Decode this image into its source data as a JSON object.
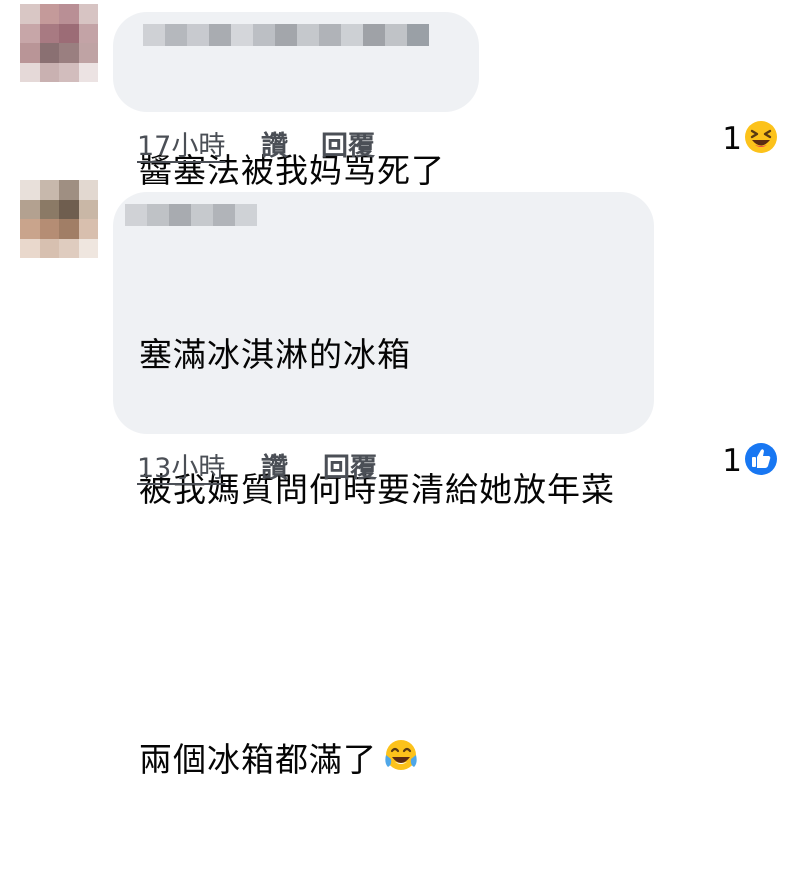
{
  "comments": [
    {
      "text_lines": [
        "醬塞法被我妈骂死了"
      ],
      "time": "17小時",
      "like_label": "讚",
      "reply_label": "回覆",
      "reaction_count": "1",
      "reaction_icon": "laughing-squint-emoji-icon"
    },
    {
      "text_lines": [
        "塞滿冰淇淋的冰箱",
        "被我媽質問何時要清給她放年菜",
        "",
        "兩個冰箱都滿了"
      ],
      "inline_emoji": "tears-of-joy-emoji-icon",
      "time": "13小時",
      "like_label": "讚",
      "reply_label": "回覆",
      "reaction_count": "1",
      "reaction_icon": "like-thumb-icon"
    }
  ],
  "colors": {
    "bubble": "#eff1f4",
    "action_text": "#4b4f56",
    "like_blue": "#1877f2",
    "emoji_yellow": "#fcc21b"
  }
}
